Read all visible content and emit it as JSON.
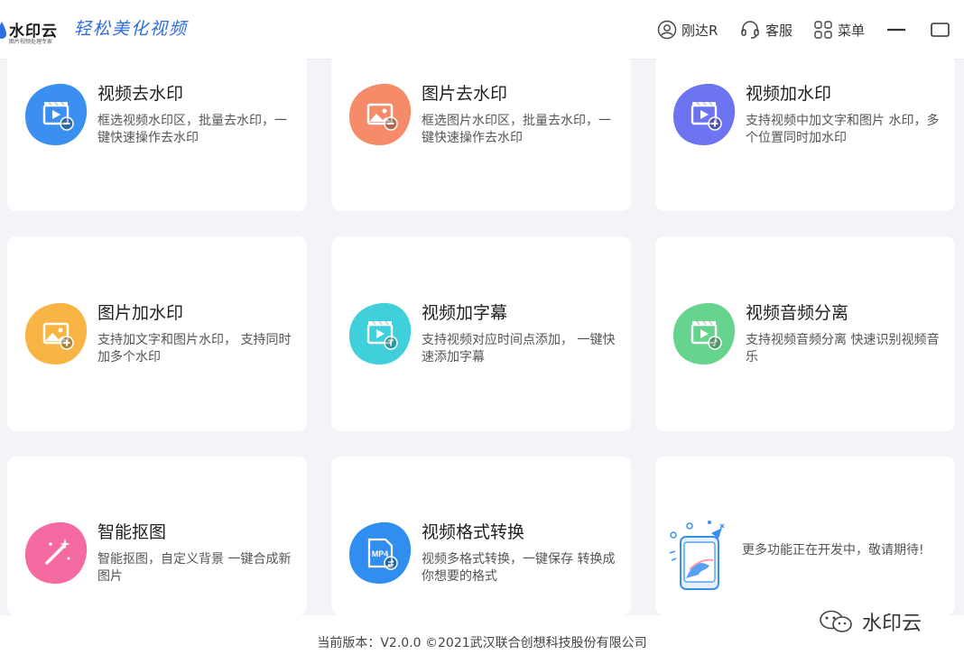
{
  "header": {
    "brand_name": "水印云",
    "brand_tagline": "图片视频处理专家",
    "slogan": "轻松美化视频",
    "user_label": "刚达R",
    "service_label": "客服",
    "menu_label": "菜单"
  },
  "cards": [
    {
      "title": "视频去水印",
      "desc": "框选视频水印区，批量去水印，一键快速操作去水印",
      "icon": "video-remove-icon",
      "color": "#3b8ff0"
    },
    {
      "title": "图片去水印",
      "desc": "框选图片水印区，批量去水印，一键快速操作去水印",
      "icon": "image-remove-icon",
      "color": "#f68b6a"
    },
    {
      "title": "视频加水印",
      "desc": "支持视频中加文字和图片 水印，多个位置同时加水印",
      "icon": "video-add-icon",
      "color": "#6c74f2"
    },
    {
      "title": "图片加水印",
      "desc": "支持加文字和图片水印， 支持同时加多个水印",
      "icon": "image-add-icon",
      "color": "#f8b545"
    },
    {
      "title": "视频加字幕",
      "desc": "支持视频对应时间点添加， 一键快速添加字幕",
      "icon": "video-subtitle-icon",
      "color": "#3fd0dc"
    },
    {
      "title": "视频音频分离",
      "desc": "支持视频音频分离 快速识别视频音乐",
      "icon": "video-audio-icon",
      "color": "#66d48e"
    },
    {
      "title": "智能抠图",
      "desc": "智能抠图，自定义背景 一键合成新图片",
      "icon": "magic-wand-icon",
      "color": "#f56aa0"
    },
    {
      "title": "视频格式转换",
      "desc": "视频多格式转换，一键保存 转换成你想要的格式",
      "icon": "mp4-convert-icon",
      "color": "#2f8ef0",
      "badge": "MP4"
    },
    {
      "title": "",
      "desc": "更多功能正在开发中，敬请期待!",
      "icon": "coming-soon-icon",
      "color": "#3b8ff0"
    }
  ],
  "footer": {
    "version_text": "当前版本：V2.0.0 ©2021武汉联合创想科技股份有限公司"
  },
  "watermark": {
    "text": "水印云"
  }
}
